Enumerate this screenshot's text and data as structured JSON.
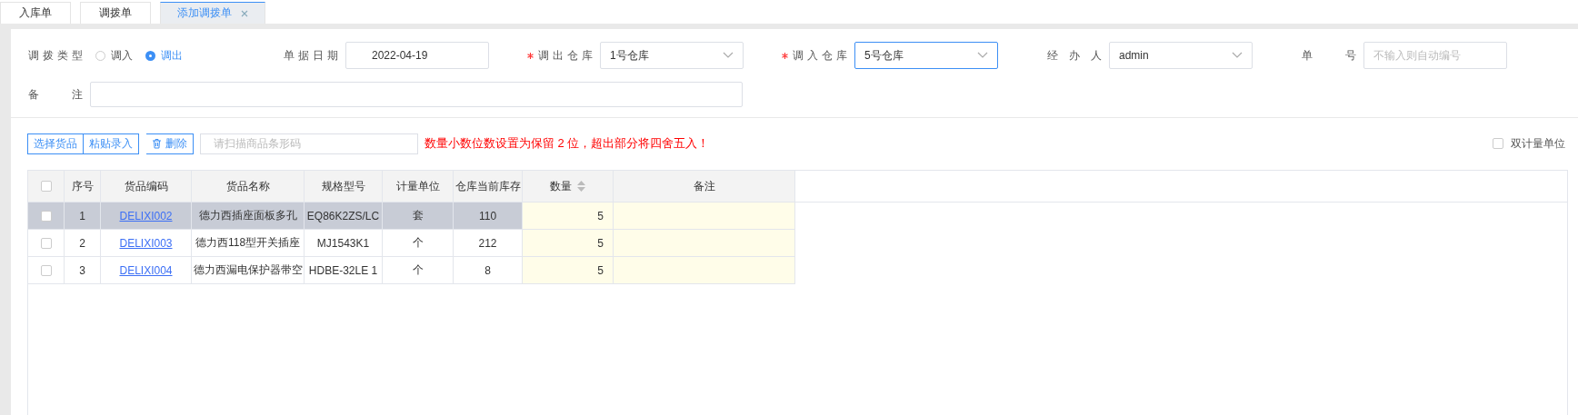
{
  "tabs": [
    {
      "label": "入库单",
      "selected": false,
      "closable": false
    },
    {
      "label": "调拨单",
      "selected": false,
      "closable": false
    },
    {
      "label": "添加调拨单",
      "selected": true,
      "closable": true
    }
  ],
  "form": {
    "transfer_type": {
      "label": "调拨类型",
      "options": [
        {
          "label": "调入",
          "selected": false
        },
        {
          "label": "调出",
          "selected": true
        }
      ]
    },
    "fields": [
      {
        "kind": "date",
        "label": "单据日期",
        "required": false,
        "focused": false,
        "value": "2022-04-19"
      },
      {
        "kind": "select",
        "label": "调出仓库",
        "required": true,
        "focused": false,
        "value": "1号仓库"
      },
      {
        "kind": "select",
        "label": "调入仓库",
        "required": true,
        "focused": true,
        "value": "5号仓库"
      },
      {
        "kind": "select",
        "label": "经办人",
        "required": false,
        "focused": false,
        "value": "admin"
      },
      {
        "kind": "text",
        "label": "单号",
        "required": false,
        "focused": false,
        "placeholder": "不输入则自动编号"
      }
    ],
    "remark": {
      "label": "备注"
    }
  },
  "toolbar": {
    "buttons": [
      "选择货品",
      "粘贴录入"
    ],
    "delete_button": "删除",
    "barcode": {
      "placeholder": "请扫描商品条形码"
    },
    "warning": "数量小数位数设置为保留 2 位，超出部分将四舍五入！",
    "dual_unit": {
      "label": "双计量单位",
      "checked": false
    }
  },
  "table": {
    "header_checked": false,
    "columns": [
      {
        "label": "序号",
        "sortable": false,
        "editable": false
      },
      {
        "label": "货品编码",
        "sortable": false,
        "editable": false
      },
      {
        "label": "货品名称",
        "sortable": false,
        "editable": false
      },
      {
        "label": "规格型号",
        "sortable": false,
        "editable": false
      },
      {
        "label": "计量单位",
        "sortable": false,
        "editable": false
      },
      {
        "label": "仓库当前库存",
        "sortable": false,
        "editable": false
      },
      {
        "label": "数量",
        "sortable": true,
        "editable": true
      },
      {
        "label": "备注",
        "sortable": false,
        "editable": true
      }
    ],
    "rows": [
      {
        "selected": true,
        "checked": false,
        "cells": [
          "1",
          "DELIXI002",
          "德力西插座面板多孔",
          "EQ86K2ZS/LC",
          "套",
          "110",
          "5",
          ""
        ]
      },
      {
        "selected": false,
        "checked": false,
        "cells": [
          "2",
          "DELIXI003",
          "德力西118型开关插座",
          "MJ1543K1",
          "个",
          "212",
          "5",
          ""
        ]
      },
      {
        "selected": false,
        "checked": false,
        "cells": [
          "3",
          "DELIXI004",
          "德力西漏电保护器带空",
          "HDBE-32LE 1",
          "个",
          "8",
          "5",
          ""
        ]
      }
    ]
  }
}
